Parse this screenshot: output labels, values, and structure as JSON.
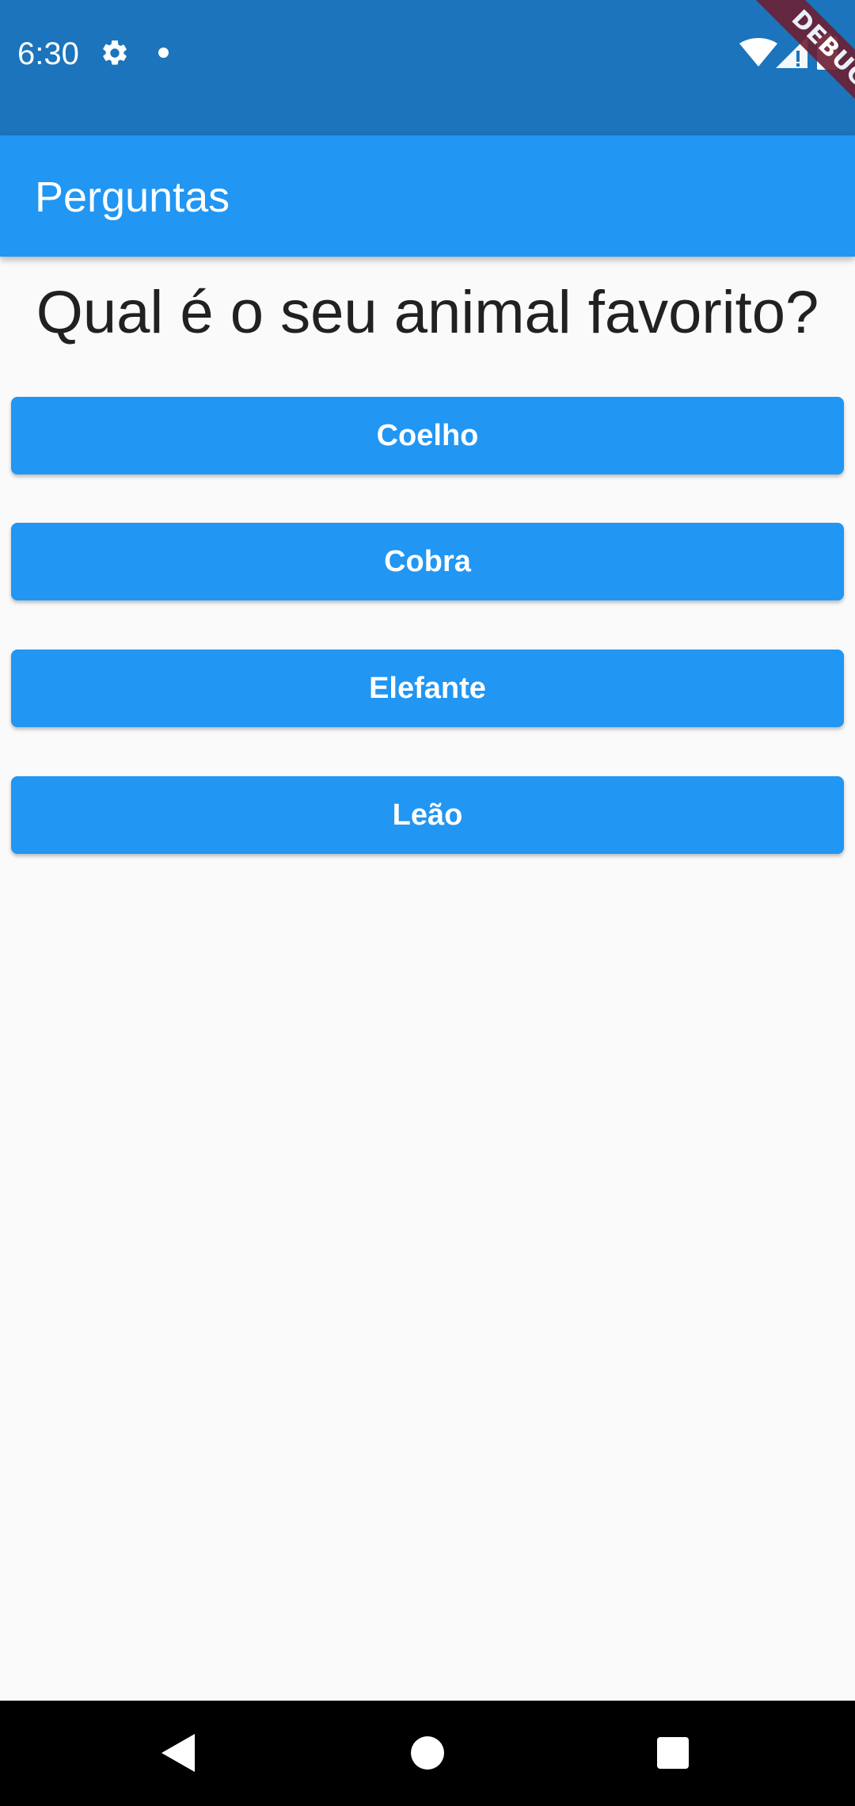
{
  "status_bar": {
    "time": "6:30",
    "icons": [
      "gear-icon",
      "notification-dot-icon",
      "wifi-icon",
      "signal-icon",
      "battery-icon"
    ]
  },
  "debug_banner": {
    "label": "DEBUG",
    "color": "#6d1f33"
  },
  "app_bar": {
    "title": "Perguntas",
    "color": "#2196f3"
  },
  "main": {
    "question": "Qual é o seu animal favorito?",
    "answers": [
      {
        "label": "Coelho"
      },
      {
        "label": "Cobra"
      },
      {
        "label": "Elefante"
      },
      {
        "label": "Leão"
      }
    ]
  },
  "nav_bar": {
    "icons": [
      "back-icon",
      "home-icon",
      "recents-icon"
    ]
  },
  "colors": {
    "status_bar": "#1b74bc",
    "primary": "#2196f3",
    "background": "#fafafa",
    "text": "#212121"
  }
}
